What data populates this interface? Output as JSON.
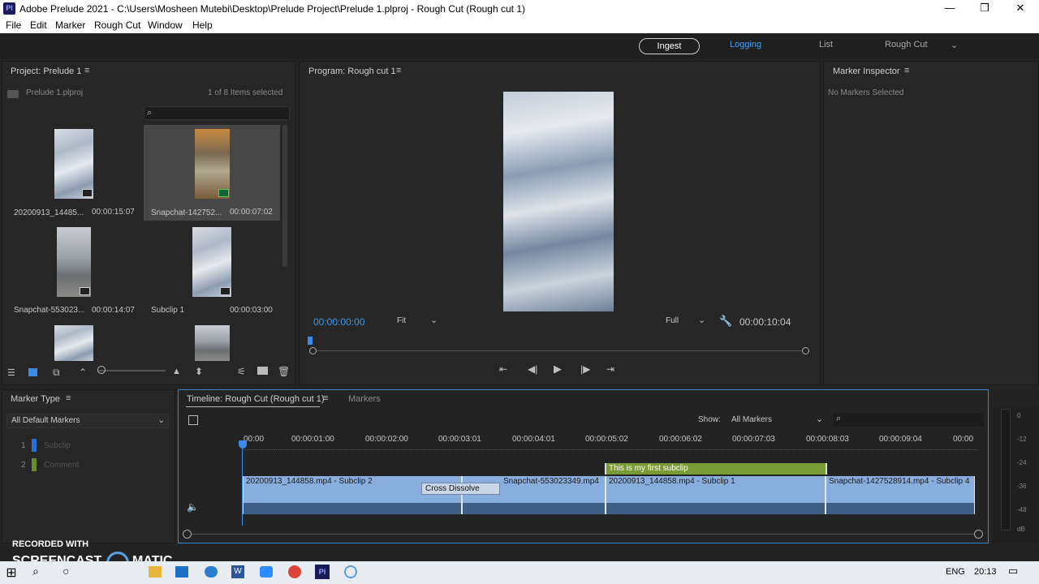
{
  "titlebar": {
    "title": "Adobe Prelude 2021 - C:\\Users\\Mosheen Mutebi\\Desktop\\Prelude Project\\Prelude 1.plproj - Rough Cut (Rough cut 1)",
    "logo": "Pl",
    "minimize": "—",
    "maximize": "❐",
    "close": "✕"
  },
  "menu": [
    "File",
    "Edit",
    "Marker",
    "Rough Cut",
    "Window",
    "Help"
  ],
  "workspaces": {
    "ingest": "Ingest",
    "logging": "Logging",
    "list": "List",
    "roughcut": "Rough Cut"
  },
  "project": {
    "title": "Project: Prelude 1",
    "file": "Prelude 1.plproj",
    "selection": "1 of 8 Items selected",
    "items": [
      {
        "name": "20200913_14485...",
        "duration": "00:00:15:07"
      },
      {
        "name": "Snapchat-142752...",
        "duration": "00:00:07:02"
      },
      {
        "name": "Snapchat-553023...",
        "duration": "00:00:14:07"
      },
      {
        "name": "Subclip 1",
        "duration": "00:00:03:00"
      }
    ]
  },
  "program": {
    "title": "Program: Rough cut 1",
    "current_tc": "00:00:00:00",
    "fit": "Fit",
    "quality": "Full",
    "duration_tc": "00:00:10:04"
  },
  "inspector": {
    "title": "Marker Inspector",
    "status": "No Markers Selected"
  },
  "markertype": {
    "title": "Marker Type",
    "filter": "All Default Markers",
    "types": [
      {
        "num": "1",
        "name": "Subclip",
        "color": "#2a6fd6"
      },
      {
        "num": "2",
        "name": "Comment",
        "color": "#6a8a2e"
      }
    ]
  },
  "timeline": {
    "tab": "Timeline: Rough Cut (Rough cut 1)",
    "markers_tab": "Markers",
    "show_label": "Show:",
    "show_value": "All Markers",
    "ruler": [
      "00:00",
      "00:00:01:00",
      "00:00:02:00",
      "00:00:03:01",
      "00:00:04:01",
      "00:00:05:02",
      "00:00:06:02",
      "00:00:07:03",
      "00:00:08:03",
      "00:00:09:04",
      "00:00"
    ],
    "marker": "This is my first subclip",
    "transition": "Cross Dissolve",
    "clips": [
      "20200913_144858.mp4 - Subclip 2",
      "Snapchat-553023349.mp4",
      "20200913_144858.mp4 - Subclip 1",
      "Snapchat-1427528914.mp4 - Subclip 4"
    ]
  },
  "meter": {
    "labels": [
      "0",
      "-12",
      "-24",
      "-36",
      "-48",
      "dB"
    ]
  },
  "watermark": {
    "recorded": "RECORDED WITH",
    "brand": "SCREENCAST",
    "brand2": "MATIC"
  },
  "taskbar": {
    "lang": "ENG",
    "time": "20:13"
  }
}
